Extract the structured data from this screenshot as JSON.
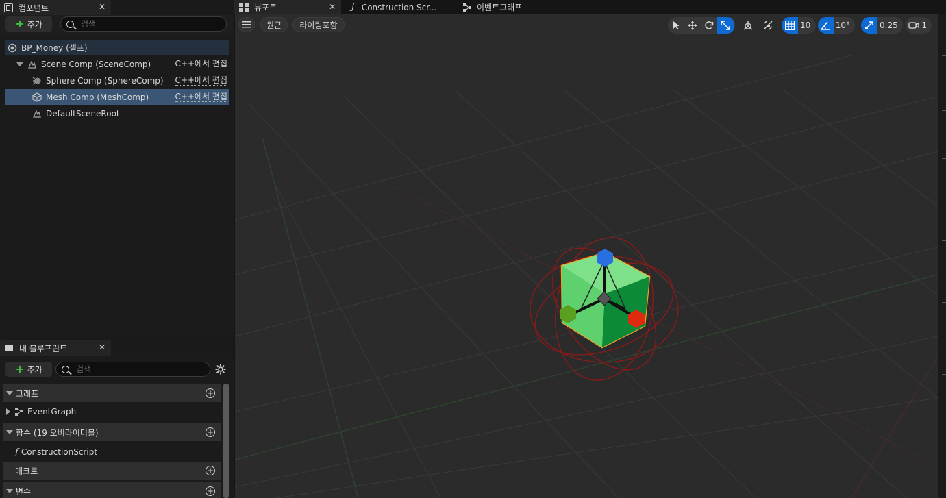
{
  "components_panel": {
    "tab_label": "컴포넌트",
    "add_label": "추가",
    "search_placeholder": "검색",
    "tree": [
      {
        "label": "BP_Money (셀프)",
        "edit": ""
      },
      {
        "label": "Scene Comp (SceneComp)",
        "edit": "C++에서 편집"
      },
      {
        "label": "Sphere Comp (SphereComp)",
        "edit": "C++에서 편집"
      },
      {
        "label": "Mesh Comp (MeshComp)",
        "edit": "C++에서 편집"
      },
      {
        "label": "DefaultSceneRoot",
        "edit": ""
      }
    ]
  },
  "blueprint_panel": {
    "tab_label": "내 블루프린트",
    "add_label": "추가",
    "search_placeholder": "검색",
    "sections": [
      {
        "label": "그래프"
      },
      {
        "label": "함수 (19 오버라이더블)"
      },
      {
        "label": "매크로"
      },
      {
        "label": "변수"
      }
    ],
    "items": [
      {
        "label": "EventGraph"
      },
      {
        "label": "ConstructionScript"
      }
    ]
  },
  "document_tabs": [
    {
      "label": "뷰포트",
      "active": true
    },
    {
      "label": "Construction Scr...",
      "active": false
    },
    {
      "label": "이벤트그래프",
      "active": false
    }
  ],
  "viewport_toolbar": {
    "perspective_label": "원근",
    "view_mode_label": "라이팅포함",
    "grid_snap_value": "10",
    "rotation_snap_value": "10°",
    "scale_snap_value": "0.25",
    "camera_speed_value": "1",
    "accent_color": "#0e6bd3"
  }
}
